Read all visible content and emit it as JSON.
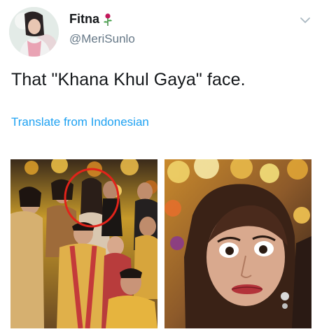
{
  "user": {
    "display_name": "Fitna",
    "name_emoji": "rose-icon",
    "handle": "@MeriSunlo",
    "avatar": "avatar-icon"
  },
  "tweet": {
    "text": "That \"Khana Khul Gaya\" face."
  },
  "actions": {
    "translate_label": "Translate from Indonesian",
    "menu_icon": "chevron-down-icon"
  },
  "media": {
    "count": 2,
    "images": [
      {
        "name": "wedding-group-photo",
        "highlight": "red-circle"
      },
      {
        "name": "surprised-face-closeup"
      }
    ]
  },
  "colors": {
    "text": "#14171a",
    "secondary": "#657786",
    "link": "#1da1f2",
    "highlight": "#e2231a"
  }
}
